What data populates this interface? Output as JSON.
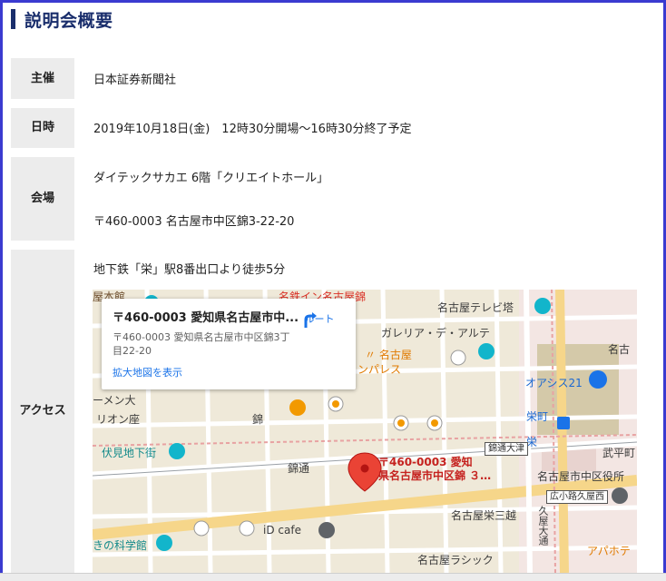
{
  "section": {
    "title": "説明会概要"
  },
  "rows": {
    "organizer": {
      "label": "主催",
      "value": "日本証券新聞社"
    },
    "datetime": {
      "label": "日時",
      "value": "2019年10月18日(金)　12時30分開場～16時30分終了予定"
    },
    "venue": {
      "label": "会場",
      "line1": "ダイテックサカエ 6階「クリエイトホール」",
      "line2": "〒460-0003 名古屋市中区錦3-22-20"
    },
    "access": {
      "label": "アクセス",
      "value": "地下鉄「栄」駅8番出口より徒歩5分"
    }
  },
  "map": {
    "infocard": {
      "title": "〒460-0003 愛知県名古屋市中...",
      "address": "〒460-0003 愛知県名古屋市中区錦3丁目22-20",
      "link": "拡大地図を表示",
      "route_label": "ルート"
    },
    "pin_label_line1": "〒460-0003 愛知",
    "pin_label_line2": "県名古屋市中区錦 ３…",
    "labels": {
      "tv_tower": "名古屋テレビ塔",
      "galleria": "ガレリア・デ・アルテ",
      "nagoya": "名古",
      "oasis": "オアシス21",
      "sakae_station": "栄町",
      "sakae": "栄",
      "nishiki": "錦",
      "nishiki_dori": "錦通",
      "fushimi": "伏見地下街",
      "orion": "リオン座",
      "menko": "ーメン大",
      "hotel_a": "〃 名古屋",
      "hotel_b": "ンパレス",
      "ward_office": "名古屋市中区役所",
      "takehira": "武平町",
      "mitsukoshi": "名古屋栄三越",
      "cafe": "iD cafe",
      "science": "きの科学館",
      "lasic": "名古屋ラシック",
      "apa": "アパホテ",
      "hisaya": "久屋大通",
      "kokusai": "ン名古屋",
      "top_left": "屋本館",
      "top_mid": "名鉄イン名古屋錦"
    },
    "road_tags": {
      "otsu": "錦通大津",
      "hirokoji": "広小路久屋西"
    }
  },
  "colors": {
    "title": "#1a2e6c",
    "frame": "#3a3ad0",
    "label_bg": "#ececec",
    "pin": "#ea4335",
    "link": "#1a73e8"
  }
}
